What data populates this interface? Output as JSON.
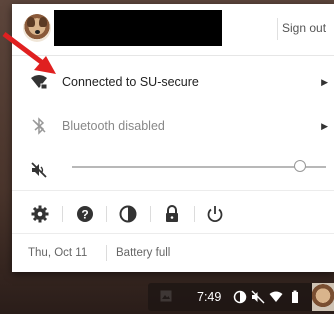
{
  "header": {
    "sign_out_label": "Sign out"
  },
  "network": {
    "label": "Connected to SU-secure",
    "icon": "wifi-locked-icon"
  },
  "bluetooth": {
    "label": "Bluetooth disabled",
    "icon": "bluetooth-disabled-icon"
  },
  "volume": {
    "icon": "volume-muted-icon",
    "level": 0.87
  },
  "quick_settings": [
    {
      "name": "settings-gear-icon"
    },
    {
      "name": "help-icon"
    },
    {
      "name": "night-light-icon"
    },
    {
      "name": "lock-icon"
    },
    {
      "name": "power-icon"
    }
  ],
  "footer": {
    "date": "Thu, Oct 11",
    "battery": "Battery full"
  },
  "shelf": {
    "time": "7:49"
  },
  "colors": {
    "annotation_arrow": "#e02020",
    "panel_bg": "#ffffff"
  }
}
